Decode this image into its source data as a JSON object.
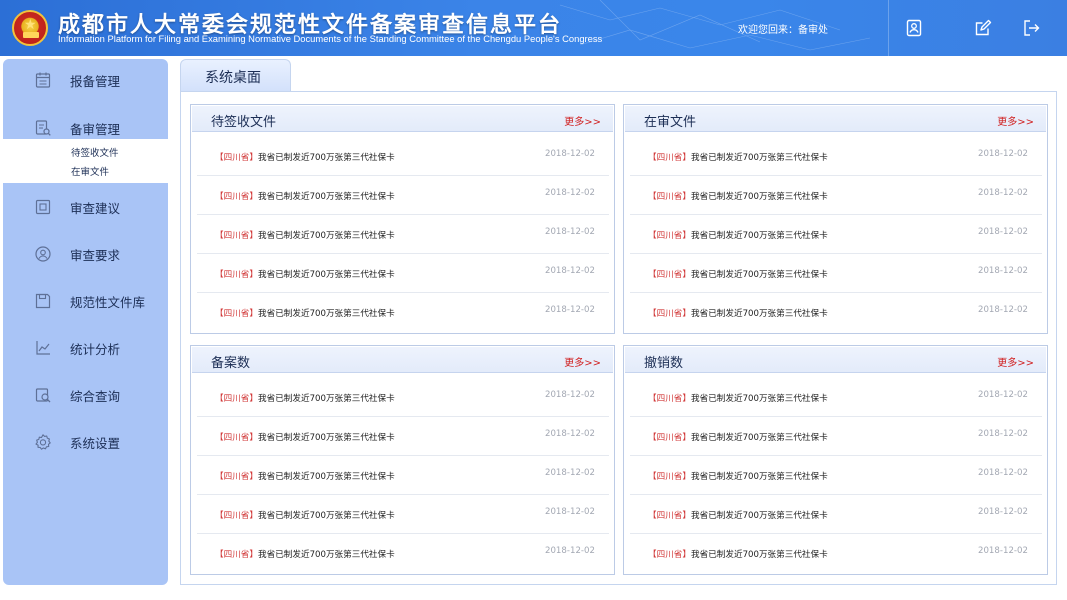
{
  "header": {
    "title_cn": "成都市人大常委会规范性文件备案审查信息平台",
    "title_en": "Information Platform for Filing and Examining Normative Documents of the Standing Committee of the Chengdu People's Congress",
    "welcome": "欢迎您回来：备审处",
    "icons": [
      "user-card-icon",
      "edit-icon",
      "logout-icon"
    ],
    "color_primary": "#3b84e8"
  },
  "sidebar": {
    "items": [
      {
        "label": "报备管理",
        "icon": "calendar-icon"
      },
      {
        "label": "备审管理",
        "icon": "document-search-icon"
      },
      {
        "label": "审查建议",
        "icon": "suggestion-icon"
      },
      {
        "label": "审查要求",
        "icon": "person-circle-icon"
      },
      {
        "label": "规范性文件库",
        "icon": "save-icon"
      },
      {
        "label": "统计分析",
        "icon": "chart-icon"
      },
      {
        "label": "综合查询",
        "icon": "search-icon"
      },
      {
        "label": "系统设置",
        "icon": "gear-icon"
      }
    ],
    "subitems": [
      "待签收文件",
      "在审文件"
    ],
    "color_bg": "#a9c4f6"
  },
  "main": {
    "tab_label": "系统桌面",
    "panels": [
      {
        "title": "待签收文件",
        "more": "更多>>",
        "rows": [
          {
            "tag": "【四川省】",
            "text": "我省已制发近700万张第三代社保卡",
            "date": "2018-12-02"
          },
          {
            "tag": "【四川省】",
            "text": "我省已制发近700万张第三代社保卡",
            "date": "2018-12-02"
          },
          {
            "tag": "【四川省】",
            "text": "我省已制发近700万张第三代社保卡",
            "date": "2018-12-02"
          },
          {
            "tag": "【四川省】",
            "text": "我省已制发近700万张第三代社保卡",
            "date": "2018-12-02"
          },
          {
            "tag": "【四川省】",
            "text": "我省已制发近700万张第三代社保卡",
            "date": "2018-12-02"
          }
        ]
      },
      {
        "title": "在审文件",
        "more": "更多>>",
        "rows": [
          {
            "tag": "【四川省】",
            "text": "我省已制发近700万张第三代社保卡",
            "date": "2018-12-02"
          },
          {
            "tag": "【四川省】",
            "text": "我省已制发近700万张第三代社保卡",
            "date": "2018-12-02"
          },
          {
            "tag": "【四川省】",
            "text": "我省已制发近700万张第三代社保卡",
            "date": "2018-12-02"
          },
          {
            "tag": "【四川省】",
            "text": "我省已制发近700万张第三代社保卡",
            "date": "2018-12-02"
          },
          {
            "tag": "【四川省】",
            "text": "我省已制发近700万张第三代社保卡",
            "date": "2018-12-02"
          }
        ]
      },
      {
        "title": "备案数",
        "more": "更多>>",
        "rows": [
          {
            "tag": "【四川省】",
            "text": "我省已制发近700万张第三代社保卡",
            "date": "2018-12-02"
          },
          {
            "tag": "【四川省】",
            "text": "我省已制发近700万张第三代社保卡",
            "date": "2018-12-02"
          },
          {
            "tag": "【四川省】",
            "text": "我省已制发近700万张第三代社保卡",
            "date": "2018-12-02"
          },
          {
            "tag": "【四川省】",
            "text": "我省已制发近700万张第三代社保卡",
            "date": "2018-12-02"
          },
          {
            "tag": "【四川省】",
            "text": "我省已制发近700万张第三代社保卡",
            "date": "2018-12-02"
          }
        ]
      },
      {
        "title": "撤销数",
        "more": "更多>>",
        "rows": [
          {
            "tag": "【四川省】",
            "text": "我省已制发近700万张第三代社保卡",
            "date": "2018-12-02"
          },
          {
            "tag": "【四川省】",
            "text": "我省已制发近700万张第三代社保卡",
            "date": "2018-12-02"
          },
          {
            "tag": "【四川省】",
            "text": "我省已制发近700万张第三代社保卡",
            "date": "2018-12-02"
          },
          {
            "tag": "【四川省】",
            "text": "我省已制发近700万张第三代社保卡",
            "date": "2018-12-02"
          },
          {
            "tag": "【四川省】",
            "text": "我省已制发近700万张第三代社保卡",
            "date": "2018-12-02"
          }
        ]
      }
    ],
    "tag_color": "#d23a3a",
    "more_color": "#d01f1f"
  }
}
